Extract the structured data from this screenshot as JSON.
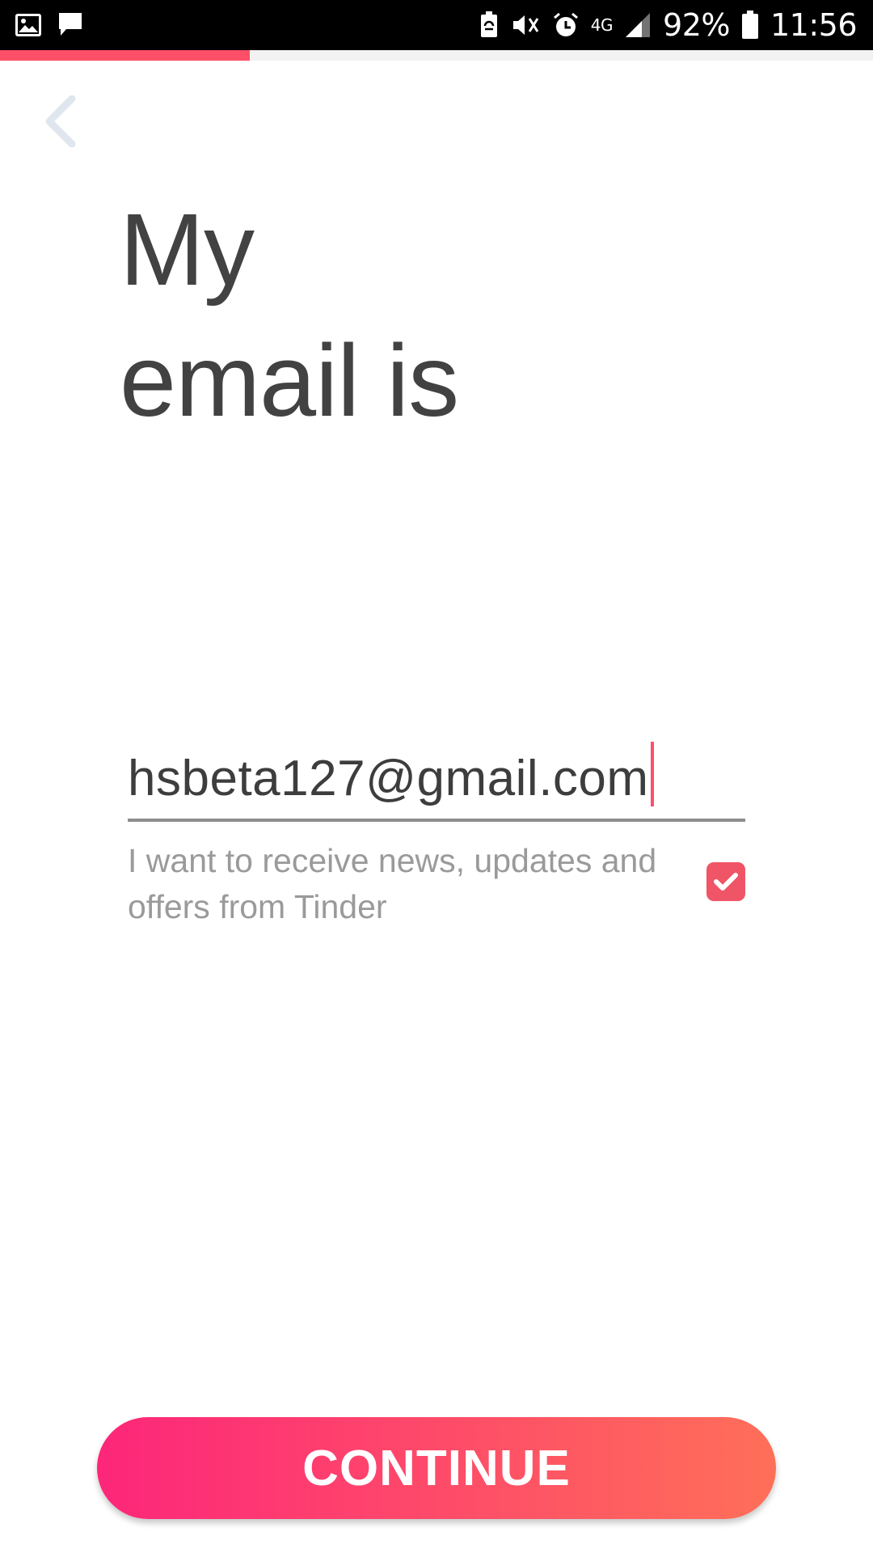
{
  "status_bar": {
    "battery_percent": "92%",
    "time": "11:56",
    "network_label": "4G",
    "left_icons": [
      "image-icon",
      "chat-icon"
    ],
    "right_icons": [
      "battery-saver-icon",
      "vibrate-icon",
      "alarm-icon",
      "network-4g-icon",
      "signal-icon",
      "battery-icon"
    ]
  },
  "progress": {
    "fraction": 0.286,
    "color": "#fd5068"
  },
  "header": {
    "back_icon": "chevron-left-icon"
  },
  "title": {
    "line1": "My",
    "line2": "email is"
  },
  "email": {
    "value": "hsbeta127@gmail.com"
  },
  "consent": {
    "text": "I want to receive news, updates and offers from Tinder",
    "checked": true,
    "color": "#ef5566"
  },
  "continue_button": {
    "label": "CONTINUE",
    "gradient_start": "#fd267a",
    "gradient_end": "#ff6f58"
  }
}
